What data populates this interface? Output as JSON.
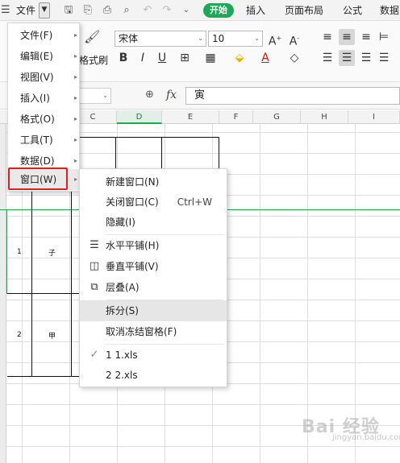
{
  "tabbar": {
    "menu_icon": "hamburger-icon",
    "file_label": "文件",
    "file_dropdown_icon": "chevron-down-icon",
    "quick_icons": [
      "save-icon",
      "export-pdf-icon",
      "print-icon",
      "print-preview-icon",
      "undo-icon",
      "redo-icon",
      "customize-icon"
    ],
    "tabs": [
      "开始",
      "插入",
      "页面布局",
      "公式",
      "数据"
    ],
    "active_tab_color": "#1aaa55"
  },
  "ribbon": {
    "font_name": "宋体",
    "font_size": "10",
    "format_brush_label": "格式刷",
    "bold": "B",
    "italic": "I",
    "underline": "U",
    "grow_font": "A+",
    "shrink_font": "A-"
  },
  "formula_bar": {
    "fx_label": "fx",
    "value": "寅"
  },
  "columns": [
    "C",
    "D",
    "E",
    "F",
    "G",
    "H",
    "I"
  ],
  "cells": {
    "row1_num": "1",
    "row1_char": "子",
    "row2_num": "2",
    "row2_char": "甲"
  },
  "main_menu": {
    "items": [
      {
        "label": "文件(F)"
      },
      {
        "label": "编辑(E)"
      },
      {
        "label": "视图(V)"
      },
      {
        "label": "插入(I)"
      },
      {
        "label": "格式(O)"
      },
      {
        "label": "工具(T)"
      },
      {
        "label": "数据(D)"
      },
      {
        "label": "窗口(W)"
      }
    ],
    "highlight_color": "#e02020"
  },
  "window_submenu": {
    "new_window": "新建窗口(N)",
    "close_window": "关闭窗口(C)",
    "close_shortcut": "Ctrl+W",
    "hide": "隐藏(I)",
    "tile_horizontal": "水平平铺(H)",
    "tile_vertical": "垂直平铺(V)",
    "cascade": "层叠(A)",
    "split": "拆分(S)",
    "unfreeze": "取消冻结窗格(F)",
    "file1": "1 1.xls",
    "file2": "2 2.xls",
    "checkmark": "✓"
  },
  "watermark": {
    "logo": "Bai 经验",
    "sub": "jingyan.baidu.com"
  }
}
